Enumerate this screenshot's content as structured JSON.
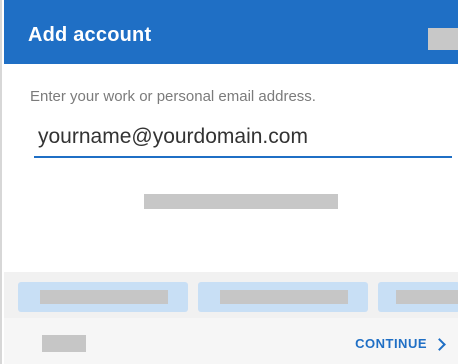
{
  "dialog": {
    "title": "Add account"
  },
  "form": {
    "prompt": "Enter your work or personal email address.",
    "email_value": "yourname@yourdomain.com"
  },
  "footer": {
    "continue_label": "CONTINUE"
  },
  "colors": {
    "accent": "#1f6fc5",
    "header_text": "#ffffff",
    "placeholder_gray": "#c6c6c6",
    "provider_button": "#c8dff5"
  }
}
